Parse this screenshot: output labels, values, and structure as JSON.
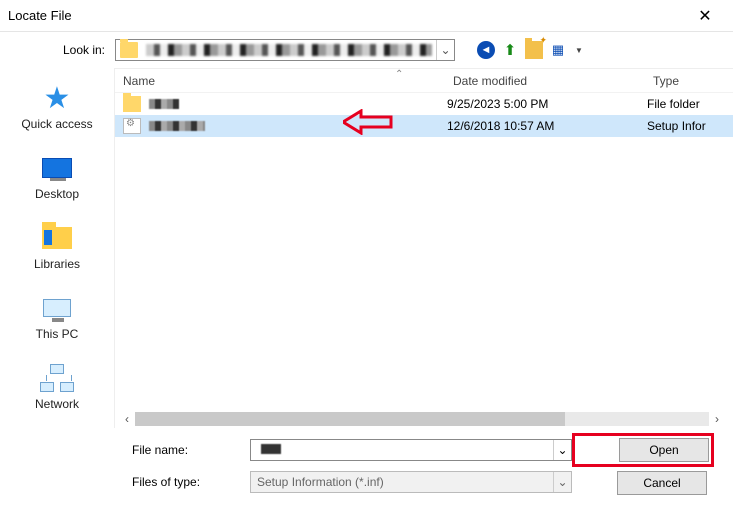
{
  "window": {
    "title": "Locate File"
  },
  "toolbar": {
    "lookin_label": "Look in:",
    "nav": {
      "back": "back-icon",
      "up": "up-one-level-icon",
      "newfolder": "new-folder-icon",
      "viewmenu": "view-menu-icon"
    }
  },
  "places": [
    {
      "id": "quick-access",
      "label": "Quick access"
    },
    {
      "id": "desktop",
      "label": "Desktop"
    },
    {
      "id": "libraries",
      "label": "Libraries"
    },
    {
      "id": "this-pc",
      "label": "This PC"
    },
    {
      "id": "network",
      "label": "Network"
    }
  ],
  "columns": {
    "name": "Name",
    "date": "Date modified",
    "type": "Type"
  },
  "rows": [
    {
      "kind": "folder",
      "date": "9/25/2023 5:00 PM",
      "type": "File folder",
      "selected": false
    },
    {
      "kind": "inf",
      "date": "12/6/2018 10:57 AM",
      "type": "Setup Infor",
      "selected": true
    }
  ],
  "bottom": {
    "filename_label": "File name:",
    "filetype_label": "Files of type:",
    "filetype_value": "Setup Information (*.inf)",
    "open": "Open",
    "cancel": "Cancel"
  }
}
